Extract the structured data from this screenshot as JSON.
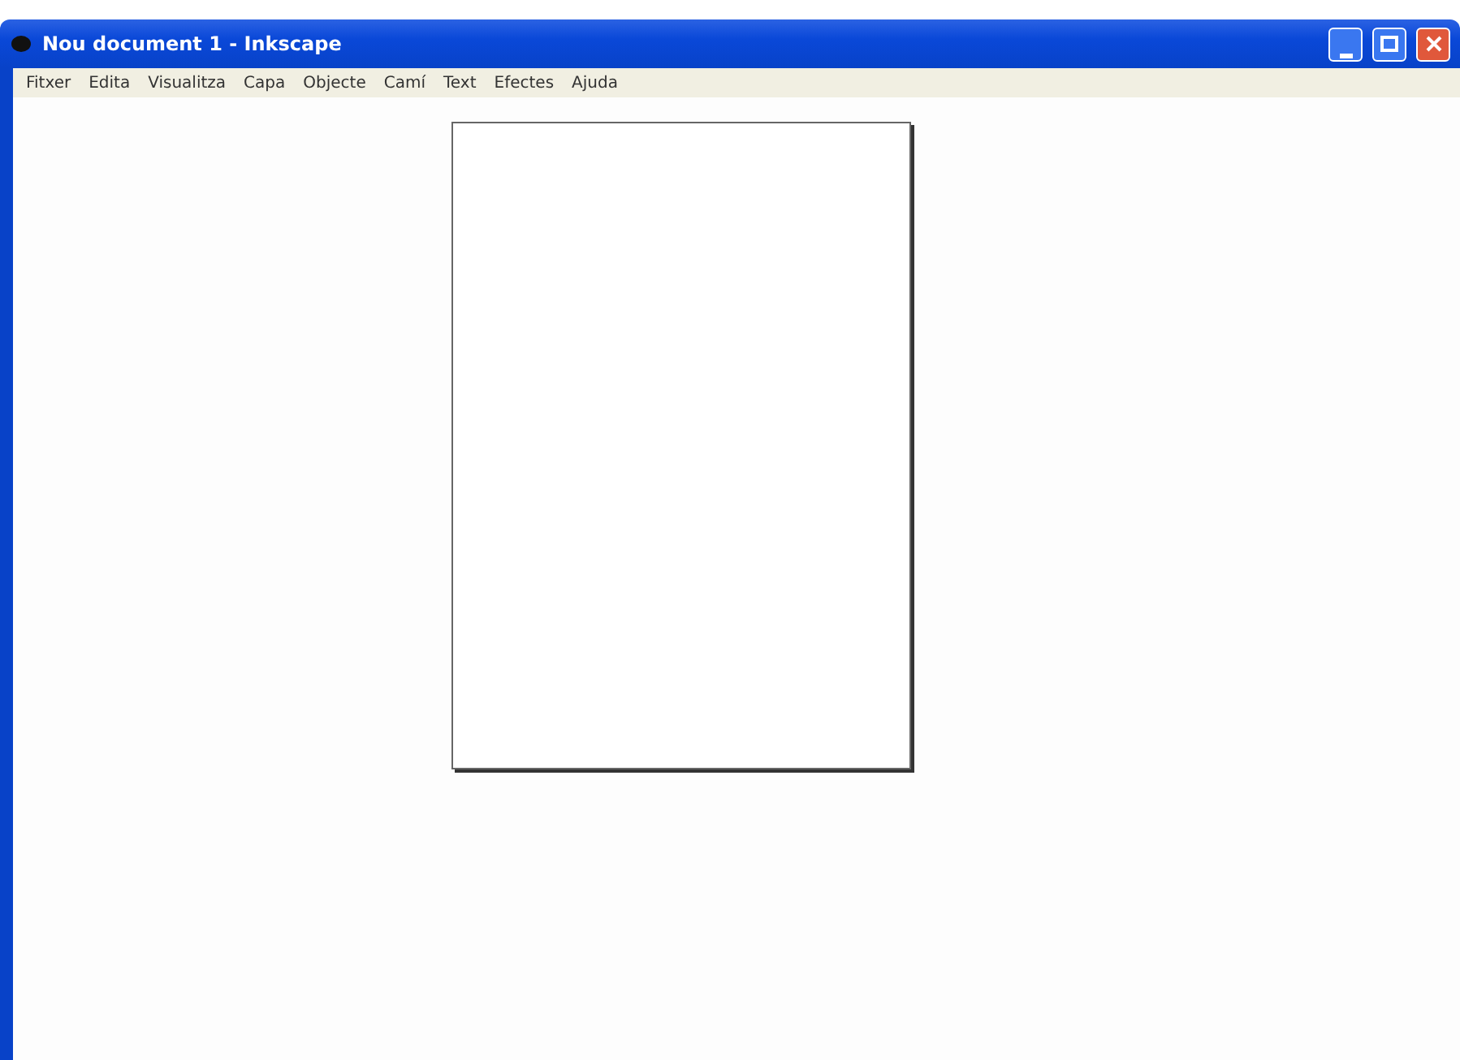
{
  "window": {
    "title": "Nou document 1 - Inkscape"
  },
  "menu": [
    "Fitxer",
    "Edita",
    "Visualitza",
    "Capa",
    "Objecte",
    "Camí",
    "Text",
    "Efectes",
    "Ajuda"
  ]
}
